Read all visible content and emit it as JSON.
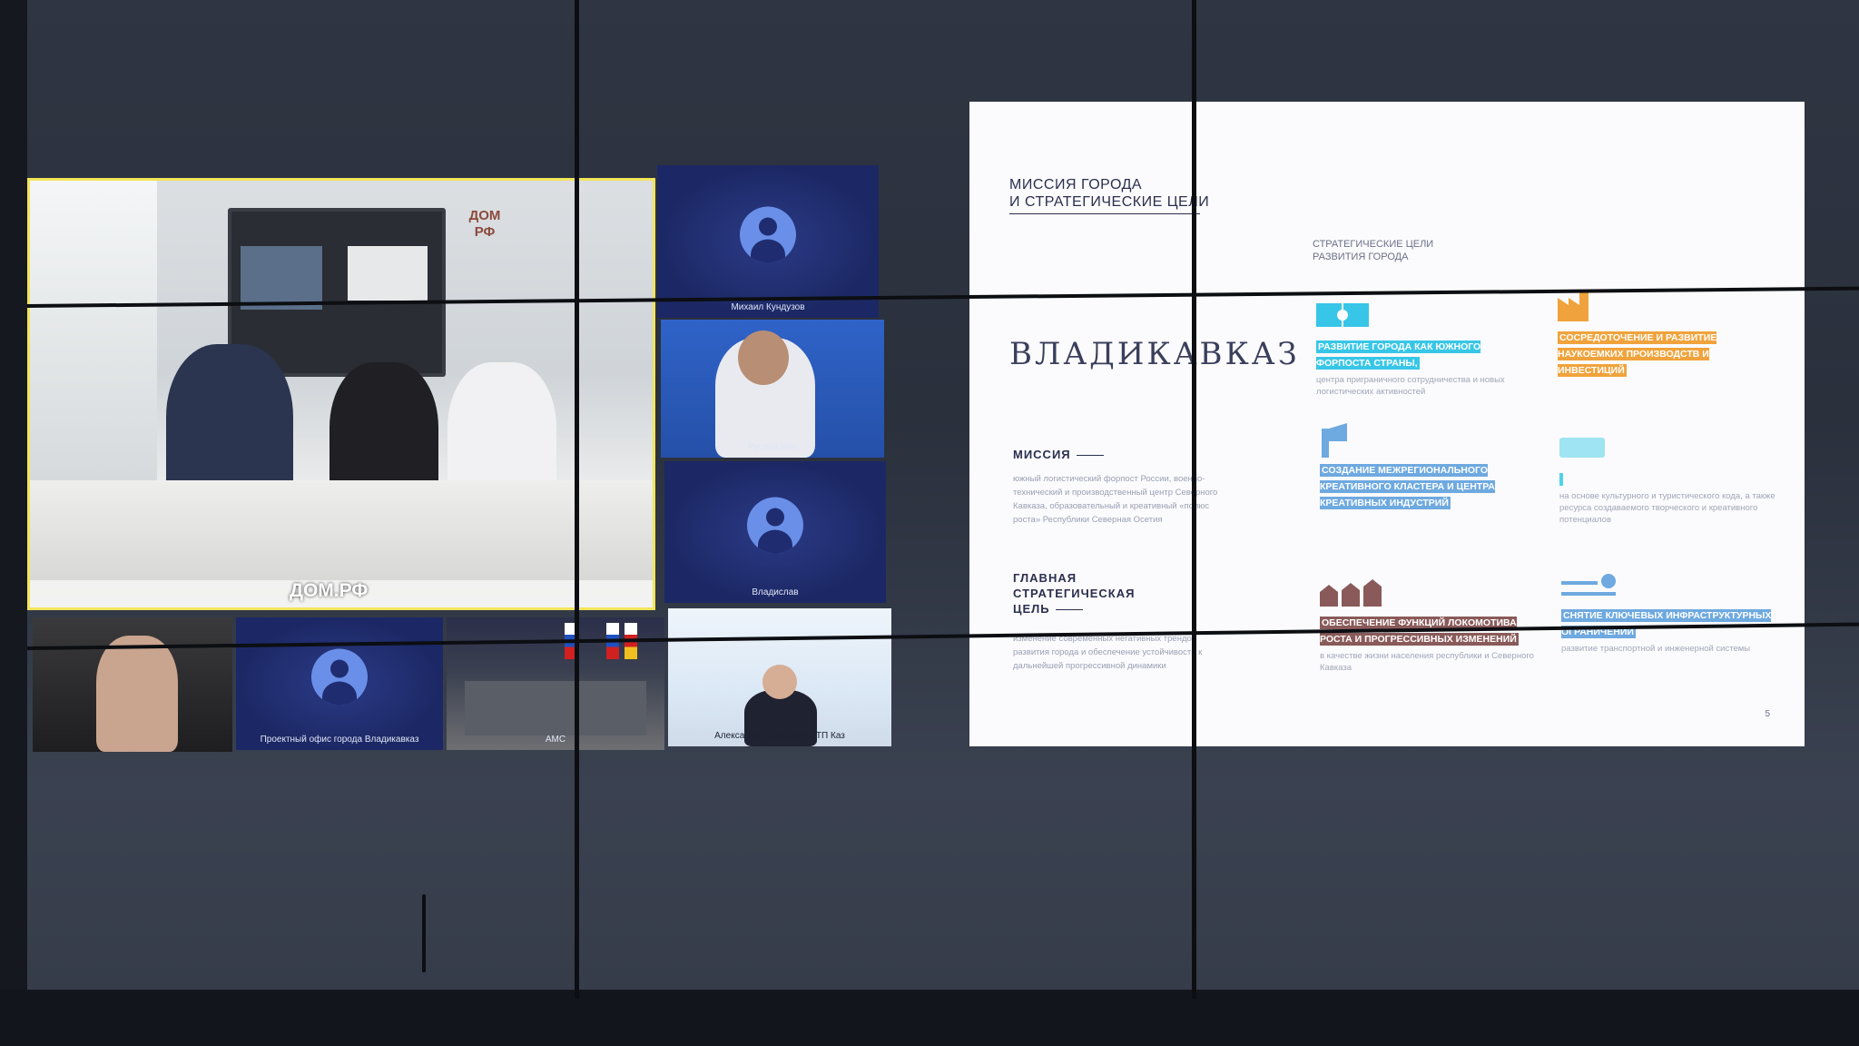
{
  "tiles": {
    "t1": "Михаил Кундузов",
    "t2": "Руслан Ибн",
    "t3": "Владислав",
    "t4": "Проектный офис города Владикавказ",
    "t5": "АМС",
    "t6": "Александр Сергеевич ИТП Каз"
  },
  "office": {
    "logo": "ДОМ\nРФ",
    "overlay": "ДОМ.РФ"
  },
  "slide": {
    "title": "МИССИЯ ГОРОДА\nИ СТРАТЕГИЧЕСКИЕ ЦЕЛИ",
    "city": "ВЛАДИКАВКАЗ",
    "mission_head": "МИССИЯ",
    "mission_text": "южный логистический форпост России, военно-технический и производственный центр Северного Кавказа, образовательный и креативный «полюс роста» Республики Северная Осетия",
    "goal_head": "ГЛАВНАЯ\nСТРАТЕГИЧЕСКАЯ\nЦЕЛЬ",
    "goal_text": "изменение современных негативных трендов развития города и обеспечение устойчивости к дальнейшей прогрессивной динамики",
    "goals_head": "СТРАТЕГИЧЕСКИЕ ЦЕЛИ\nРАЗВИТИЯ ГОРОДА",
    "goals": [
      {
        "title": "РАЗВИТИЕ ГОРОДА КАК ЮЖНОГО ФОРПОСТА СТРАНЫ,",
        "desc": "центра приграничного сотрудничества и новых логистических активностей",
        "color": "#38c6e8"
      },
      {
        "title": "СОСРЕДОТОЧЕНИЕ И РАЗВИТИЕ НАУКОЕМКИХ ПРОИЗВОДСТВ И ИНВЕСТИЦИЙ",
        "desc": "",
        "color": "#f0a33c"
      },
      {
        "title": "СОЗДАНИЕ МЕЖРЕГИОНАЛЬНОГО КРЕАТИВНОГО КЛАСТЕРА И ЦЕНТРА КРЕАТИВНЫХ ИНДУСТРИЙ",
        "desc": "",
        "color": "#6ea9e0"
      },
      {
        "title": "",
        "desc": "на основе культурного и туристического кода, а также ресурса создаваемого творческого и креативного потенциалов",
        "color": "#52d2ea"
      },
      {
        "title": "ОБЕСПЕЧЕНИЕ ФУНКЦИЙ ЛОКОМОТИВА РОСТА И ПРОГРЕССИВНЫХ ИЗМЕНЕНИЙ",
        "desc": "в качестве жизни населения республики и Северного Кавказа",
        "color": "#8a5a5a"
      },
      {
        "title": "СНЯТИЕ КЛЮЧЕВЫХ ИНФРАСТРУКТУРНЫХ ОГРАНИЧЕНИЙ",
        "desc": "развитие транспортной и инженерной системы",
        "color": "#6ea9e0"
      }
    ],
    "page": "5"
  }
}
